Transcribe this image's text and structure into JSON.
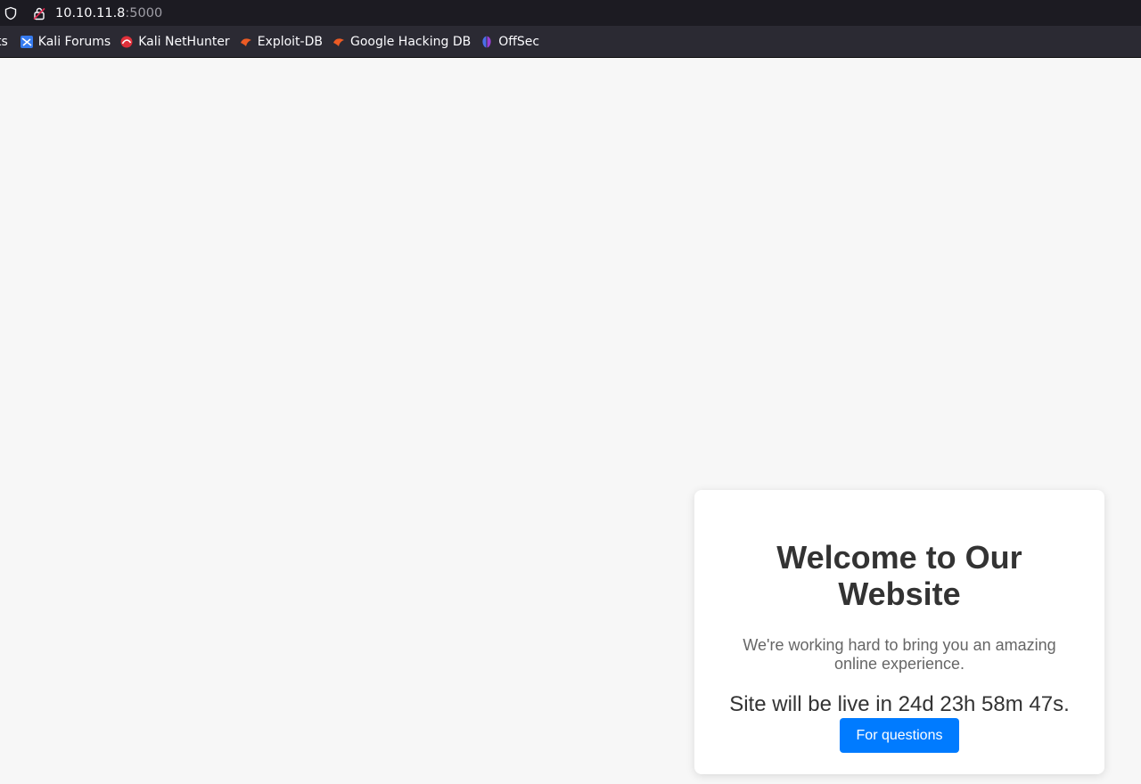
{
  "browser": {
    "url_host": "10.10.11.8",
    "url_port": ":5000"
  },
  "bookmarks": {
    "partial_label": "ts",
    "items": [
      {
        "label": "Kali Forums",
        "icon": "kali-forums-icon"
      },
      {
        "label": "Kali NetHunter",
        "icon": "kali-nethunter-icon"
      },
      {
        "label": "Exploit-DB",
        "icon": "exploit-db-icon"
      },
      {
        "label": "Google Hacking DB",
        "icon": "google-hacking-db-icon"
      },
      {
        "label": "OffSec",
        "icon": "offsec-icon"
      }
    ]
  },
  "card": {
    "title": "Welcome to Our Website",
    "subtitle": "We're working hard to bring you an amazing online experience.",
    "countdown": "Site will be live in 24d 23h 58m 47s.",
    "button_label": "For questions"
  },
  "colors": {
    "accent": "#007bff",
    "page_bg": "#f7f7f7"
  }
}
